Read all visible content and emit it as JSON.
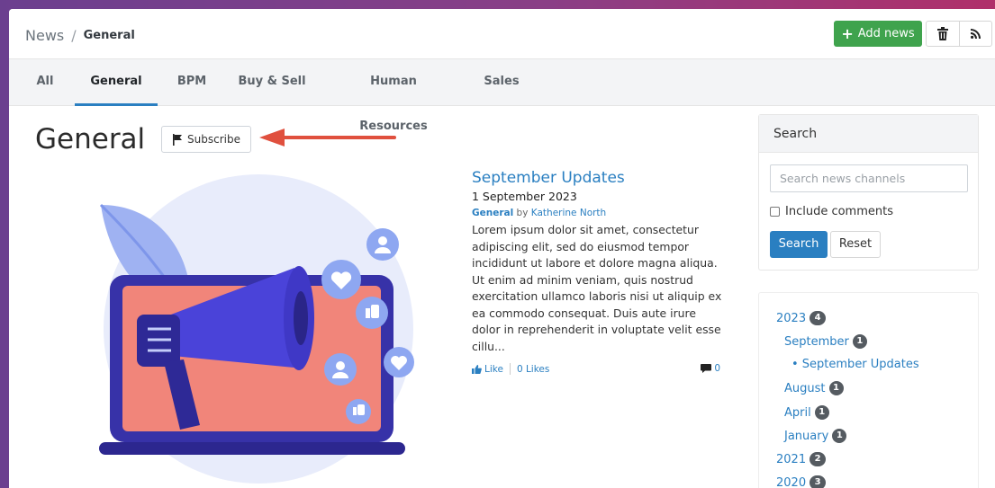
{
  "breadcrumb": {
    "root": "News",
    "separator": "/",
    "current": "General"
  },
  "toolbar": {
    "add_label": "Add news"
  },
  "tabs": [
    {
      "label": "All"
    },
    {
      "label": "General"
    },
    {
      "label": "BPM"
    },
    {
      "label": "Buy & Sell"
    },
    {
      "label": "Human Resources"
    },
    {
      "label": "Sales"
    }
  ],
  "active_tab": "General",
  "page": {
    "title": "General",
    "subscribe_label": "Subscribe"
  },
  "article": {
    "title": "September Updates",
    "date": "1 September 2023",
    "category": "General",
    "by": "by",
    "author": "Katherine North",
    "body": "Lorem ipsum dolor sit amet, consectetur adipiscing elit, sed do eiusmod tempor incididunt ut labore et dolore magna aliqua. Ut enim ad minim veniam, quis nostrud exercitation ullamco laboris nisi ut aliquip ex ea commodo consequat. Duis aute irure dolor in reprehenderit in voluptate velit esse cillu...",
    "like_label": "Like",
    "likes_label": "0 Likes",
    "comments_count": "0"
  },
  "search": {
    "header": "Search",
    "placeholder": "Search news channels",
    "include_comments": "Include comments",
    "search_button": "Search",
    "reset_button": "Reset"
  },
  "archive": [
    {
      "label": "2023",
      "count": "4"
    },
    {
      "label": "September",
      "count": "1"
    },
    {
      "label": "• September Updates"
    },
    {
      "label": "August",
      "count": "1"
    },
    {
      "label": "April",
      "count": "1"
    },
    {
      "label": "January",
      "count": "1"
    },
    {
      "label": "2021",
      "count": "2"
    },
    {
      "label": "2020",
      "count": "3"
    }
  ],
  "colors": {
    "primary": "#2a7fc1",
    "success": "#3fa34d",
    "annotation_arrow": "#e0503e",
    "badge": "#555b61"
  }
}
